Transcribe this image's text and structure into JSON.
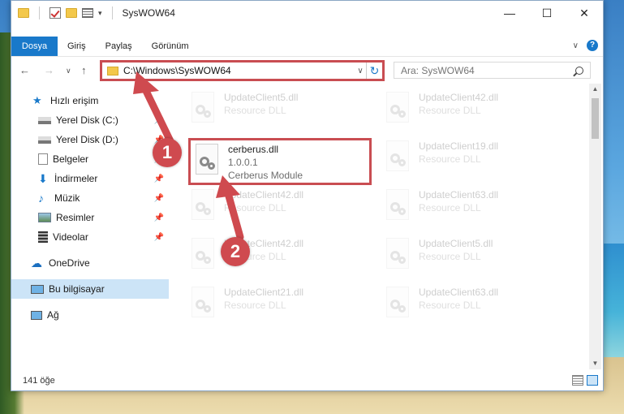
{
  "window": {
    "title": "SysWOW64",
    "controls": {
      "minimize": "—",
      "maximize": "☐",
      "close": "✕"
    }
  },
  "ribbon": {
    "tabs": [
      "Dosya",
      "Giriş",
      "Paylaş",
      "Görünüm"
    ],
    "expand_icon": "chevron-down-icon",
    "help_label": "?"
  },
  "address_bar": {
    "path": "C:\\Windows\\SysWOW64",
    "search_placeholder": "Ara: SysWOW64"
  },
  "nav_pane": {
    "items": [
      {
        "label": "Hızlı erişim",
        "icon": "star-icon",
        "pinned": false,
        "selected": false
      },
      {
        "label": "Yerel Disk (C:)",
        "icon": "drive-icon",
        "pinned": true,
        "selected": false
      },
      {
        "label": "Yerel Disk (D:)",
        "icon": "drive-icon",
        "pinned": true,
        "selected": false
      },
      {
        "label": "Belgeler",
        "icon": "documents-icon",
        "pinned": true,
        "selected": false
      },
      {
        "label": "İndirmeler",
        "icon": "download-icon",
        "pinned": true,
        "selected": false
      },
      {
        "label": "Müzik",
        "icon": "music-icon",
        "pinned": true,
        "selected": false
      },
      {
        "label": "Resimler",
        "icon": "pictures-icon",
        "pinned": true,
        "selected": false
      },
      {
        "label": "Videolar",
        "icon": "videos-icon",
        "pinned": true,
        "selected": false
      },
      {
        "label": "OneDrive",
        "icon": "cloud-icon",
        "pinned": false,
        "selected": false
      },
      {
        "label": "Bu bilgisayar",
        "icon": "computer-icon",
        "pinned": false,
        "selected": true
      },
      {
        "label": "Ağ",
        "icon": "network-icon",
        "pinned": false,
        "selected": false
      }
    ]
  },
  "files": [
    {
      "name": "UpdateClient5.dll",
      "sub": "Resource DLL",
      "faded": true
    },
    {
      "name": "UpdateClient42.dll",
      "sub": "Resource DLL",
      "faded": true
    },
    {
      "name": "cerberus.dll",
      "version": "1.0.0.1",
      "sub": "Cerberus Module",
      "faded": false,
      "highlighted": true
    },
    {
      "name": "UpdateClient19.dll",
      "sub": "Resource DLL",
      "faded": true
    },
    {
      "name": "UpdateClient42.dll",
      "sub": "Resource DLL",
      "faded": true
    },
    {
      "name": "UpdateClient63.dll",
      "sub": "Resource DLL",
      "faded": true
    },
    {
      "name": "UpdateClient42.dll",
      "sub": "Resource DLL",
      "faded": true
    },
    {
      "name": "UpdateClient5.dll",
      "sub": "Resource DLL",
      "faded": true
    },
    {
      "name": "UpdateClient21.dll",
      "sub": "Resource DLL",
      "faded": true
    },
    {
      "name": "UpdateClient63.dll",
      "sub": "Resource DLL",
      "faded": true
    }
  ],
  "status": {
    "count_text": "141 öğe"
  },
  "annotations": {
    "step1": "1",
    "step2": "2",
    "color": "#cf4a4f"
  }
}
